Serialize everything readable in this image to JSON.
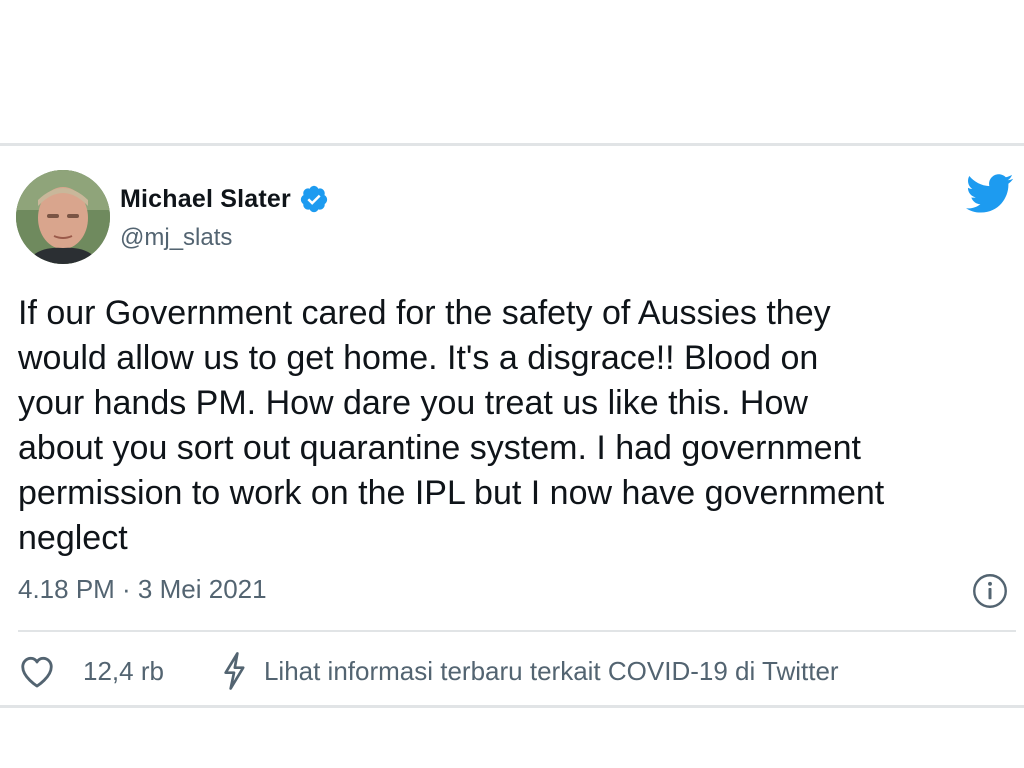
{
  "tweet": {
    "author_name": "Michael Slater",
    "handle": "@mj_slats",
    "text": "If our Government cared for the safety of Aussies they\nwould allow us to get home. It's a disgrace!! Blood on\nyour hands PM. How dare you treat us like this. How\nabout you sort out quarantine system. I had government\npermission to work on the IPL but I now have government\nneglect",
    "timestamp": "4.18 PM · 3 Mei 2021",
    "likes": "12,4 rb",
    "covid_link": "Lihat informasi terbaru terkait COVID-19 di Twitter"
  },
  "icons": {
    "verified": "verified-badge-icon",
    "brand": "twitter-bird-icon",
    "info": "info-icon",
    "like": "heart-icon",
    "covid": "lightning-bolt-icon"
  },
  "colors": {
    "brand_blue": "#1d9bf0",
    "text_primary": "#0f1419",
    "text_secondary": "#536471",
    "border": "#e1e4e6"
  }
}
